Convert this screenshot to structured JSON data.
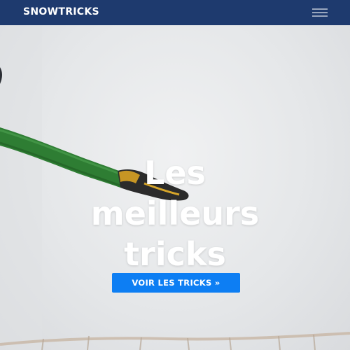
{
  "navbar": {
    "brand": "SNOWTRICKS",
    "menu_icon": "hamburger-menu-icon"
  },
  "hero": {
    "title_lines": [
      "Les",
      "meilleurs",
      "tricks"
    ],
    "cta_label": "VOIR LES TRICKS »"
  },
  "colors": {
    "navbar": "#1e3a6e",
    "cta": "#0d7ef3",
    "text": "#ffffff"
  }
}
